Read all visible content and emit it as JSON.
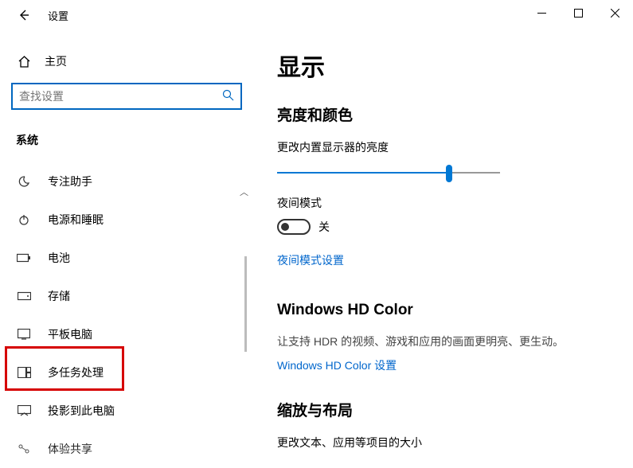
{
  "titlebar": {
    "title": "设置"
  },
  "sidebar": {
    "home_label": "主页",
    "search_placeholder": "查找设置",
    "section_header": "系统",
    "items": [
      {
        "label": "专注助手"
      },
      {
        "label": "电源和睡眠"
      },
      {
        "label": "电池"
      },
      {
        "label": "存储"
      },
      {
        "label": "平板电脑"
      },
      {
        "label": "多任务处理"
      },
      {
        "label": "投影到此电脑"
      },
      {
        "label": "体验共享"
      }
    ]
  },
  "content": {
    "page_title": "显示",
    "brightness_header": "亮度和颜色",
    "brightness_label": "更改内置显示器的亮度",
    "brightness_value_pct": 77,
    "night_light_label": "夜间模式",
    "night_light_state": "关",
    "night_light_link": "夜间模式设置",
    "hd_header": "Windows HD Color",
    "hd_desc": "让支持 HDR 的视频、游戏和应用的画面更明亮、更生动。",
    "hd_link": "Windows HD Color 设置",
    "scale_header": "缩放与布局",
    "scale_label": "更改文本、应用等项目的大小"
  }
}
